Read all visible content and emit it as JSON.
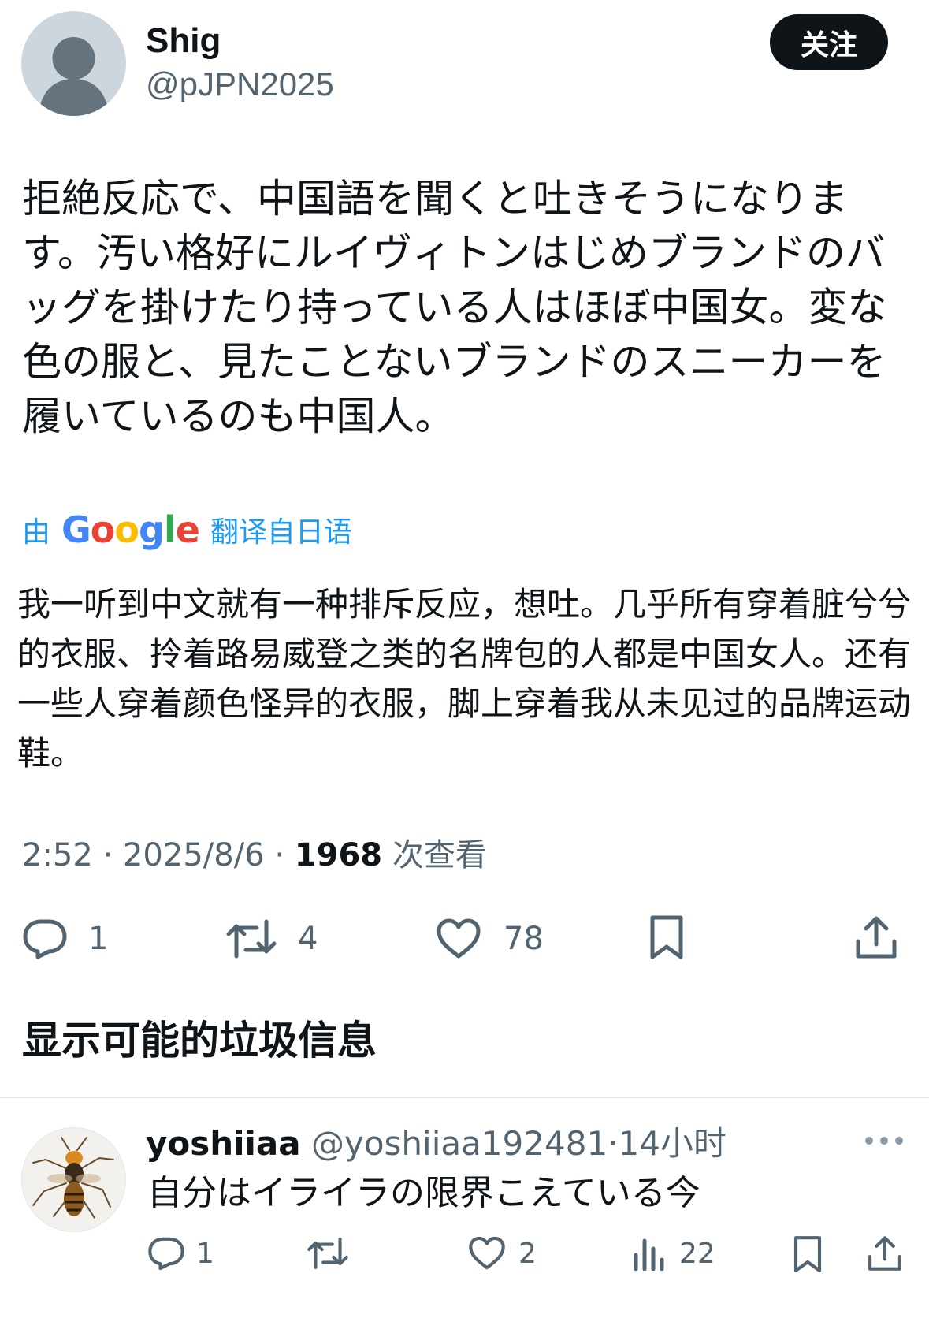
{
  "tweet": {
    "author": {
      "name": "Shig",
      "handle": "@pJPN2025"
    },
    "follow_label": "关注",
    "text": "拒絶反応で、中国語を聞くと吐きそうになります。汚い格好にルイヴィトンはじめブランドのバッグを掛けたり持っている人はほぼ中国女。変な色の服と、見たことないブランドのスニーカーを履いているのも中国人。",
    "translate": {
      "prefix": "由",
      "brand": "Google",
      "suffix": "翻译自日语"
    },
    "translation": "我一听到中文就有一种排斥反应，想吐。几乎所有穿着脏兮兮的衣服、拎着路易威登之类的名牌包的人都是中国女人。还有一些人穿着颜色怪异的衣服，脚上穿着我从未见过的品牌运动鞋。",
    "meta": {
      "time": "2:52",
      "date": "2025/8/6",
      "views": "1968",
      "views_label": "次查看",
      "sep": " · "
    },
    "actions": {
      "replies": "1",
      "reposts": "4",
      "likes": "78"
    }
  },
  "spam_link": "显示可能的垃圾信息",
  "reply": {
    "name": "yoshiiaa",
    "handle": "@yoshiiaa192481",
    "sep": "·",
    "time": "14小时",
    "text": "自分はイライラの限界こえている今",
    "actions": {
      "replies": "1",
      "reposts": "",
      "likes": "2",
      "views": "22"
    }
  },
  "colors": {
    "accent": "#1d9bf0",
    "text": "#0f1419",
    "muted": "#536471"
  },
  "icons": [
    "avatar-placeholder",
    "reply-icon",
    "repost-icon",
    "like-icon",
    "bookmark-icon",
    "share-icon",
    "views-icon",
    "more-icon"
  ]
}
